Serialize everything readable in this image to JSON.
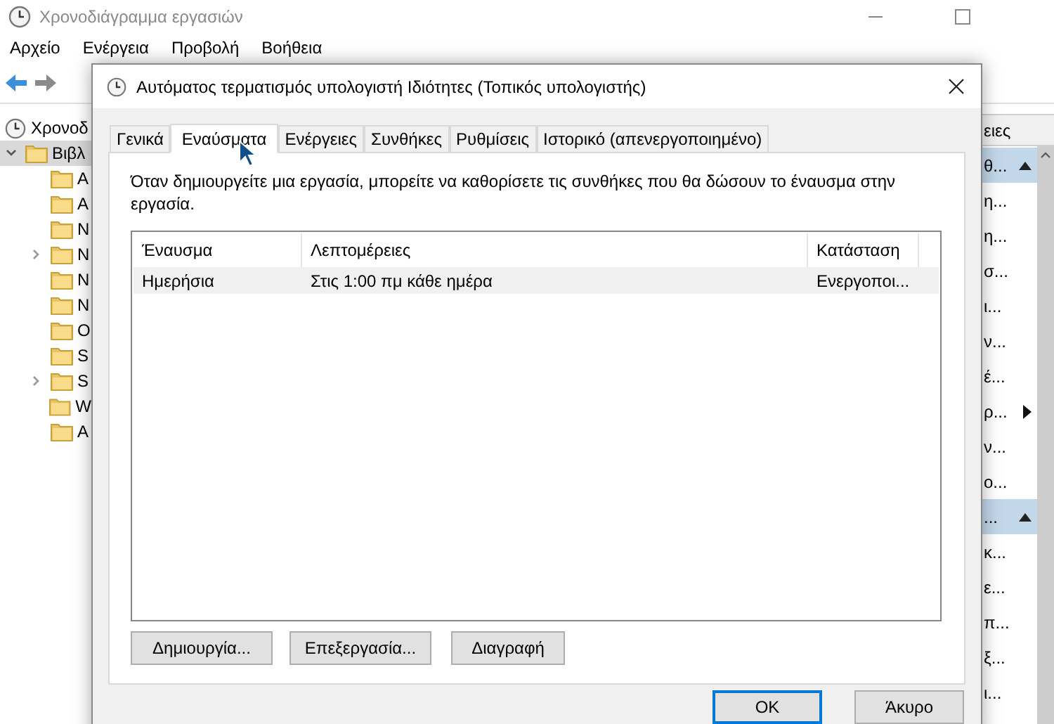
{
  "background_window": {
    "title": "Χρονοδιάγραμμα εργασιών",
    "menu": [
      "Αρχείο",
      "Ενέργεια",
      "Προβολή",
      "Βοήθεια"
    ],
    "tree": [
      {
        "label": "Χρονοδ",
        "selected": false,
        "children": [
          {
            "label": "Βιβλ",
            "expanded": true,
            "selected": true,
            "children": [
              {
                "label": "A",
                "has_children": false
              },
              {
                "label": "A",
                "has_children": false
              },
              {
                "label": "N",
                "has_children": false
              },
              {
                "label": "N",
                "has_children": true
              },
              {
                "label": "N",
                "has_children": false
              },
              {
                "label": "N",
                "has_children": false
              },
              {
                "label": "O",
                "has_children": false
              },
              {
                "label": "S",
                "has_children": false
              },
              {
                "label": "S",
                "has_children": true
              },
              {
                "label": "W",
                "has_children": false
              },
              {
                "label": "A",
                "has_children": false
              }
            ]
          }
        ]
      }
    ],
    "actions_pane": {
      "header": "ειες",
      "items": [
        {
          "label": "θ...",
          "kind": "group"
        },
        {
          "label": "η...",
          "kind": "item"
        },
        {
          "label": "η...",
          "kind": "item"
        },
        {
          "label": "σ...",
          "kind": "item"
        },
        {
          "label": "ι...",
          "kind": "item"
        },
        {
          "label": "ν...",
          "kind": "item"
        },
        {
          "label": "έ...",
          "kind": "item"
        },
        {
          "label": "ρ...",
          "kind": "submenu"
        },
        {
          "label": "ν...",
          "kind": "item"
        },
        {
          "label": "ο...",
          "kind": "item"
        },
        {
          "label": "...",
          "kind": "group"
        },
        {
          "label": "κ...",
          "kind": "item"
        },
        {
          "label": "ε...",
          "kind": "item"
        },
        {
          "label": "π...",
          "kind": "item"
        },
        {
          "label": "ξ...",
          "kind": "item"
        },
        {
          "label": "ι...",
          "kind": "item"
        }
      ]
    }
  },
  "dialog": {
    "title": "Αυτόματος τερματισμός υπολογιστή Ιδιότητες (Τοπικός υπολογιστής)",
    "tabs": [
      {
        "label": "Γενικά",
        "selected": false
      },
      {
        "label": "Εναύσματα",
        "selected": true
      },
      {
        "label": "Ενέργειες",
        "selected": false
      },
      {
        "label": "Συνθήκες",
        "selected": false
      },
      {
        "label": "Ρυθμίσεις",
        "selected": false
      },
      {
        "label": "Ιστορικό (απενεργοποιημένο)",
        "selected": false
      }
    ],
    "description": "Όταν δημιουργείτε μια εργασία, μπορείτε να καθορίσετε τις συνθήκες που θα δώσουν το έναυσμα στην εργασία.",
    "table": {
      "columns": [
        "Έναυσμα",
        "Λεπτομέρειες",
        "Κατάσταση"
      ],
      "rows": [
        {
          "cells": [
            "Ημερήσια",
            "Στις 1:00 πμ κάθε ημέρα",
            "Ενεργοποι..."
          ],
          "selected": true
        }
      ]
    },
    "list_buttons": [
      "Δημιουργία...",
      "Επεξεργασία...",
      "Διαγραφή"
    ],
    "footer_buttons": [
      {
        "label": "OK",
        "default": true
      },
      {
        "label": "Άκυρο",
        "default": false
      }
    ]
  }
}
